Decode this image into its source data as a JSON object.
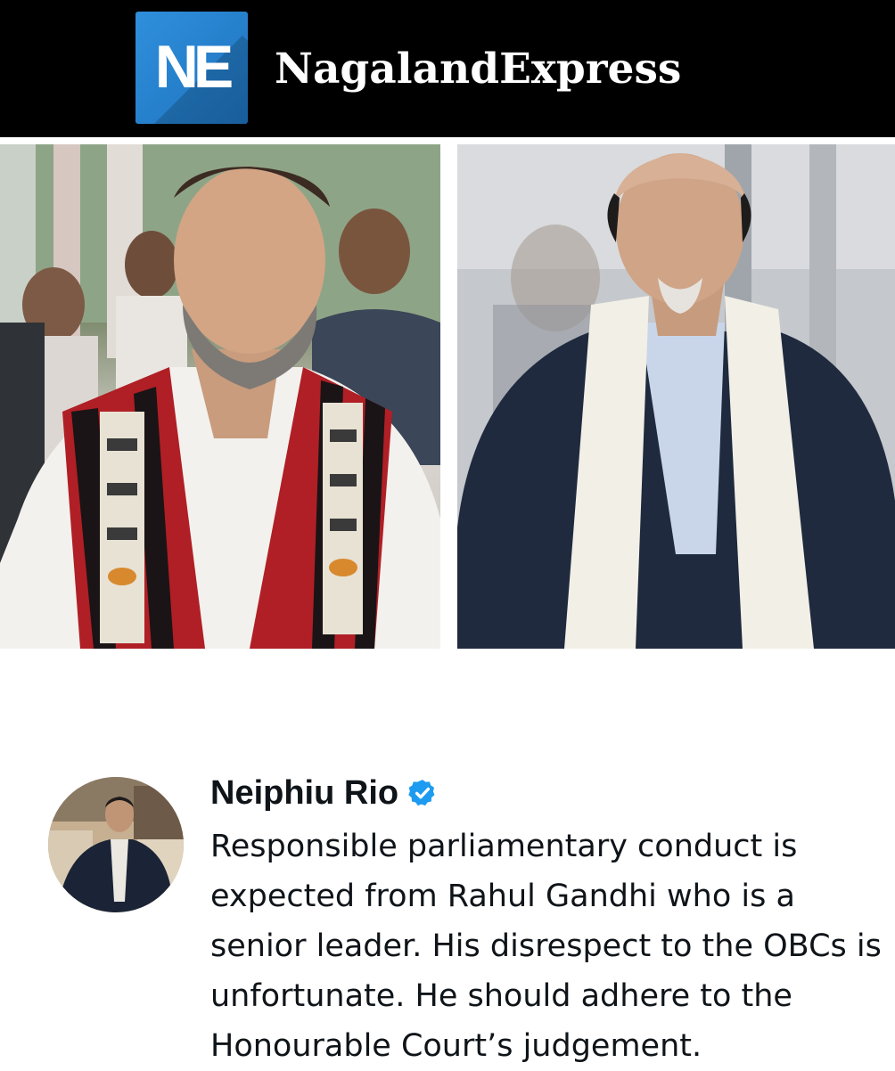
{
  "header": {
    "logo_text": "NE",
    "brand_name": "NagalandExpress",
    "background": "#000000",
    "logo_color": "#2a87d4"
  },
  "photos": {
    "left": "rahul-gandhi-photo",
    "right": "neiphiu-rio-photo"
  },
  "tweet": {
    "author": "Neiphiu Rio",
    "verified": true,
    "verified_color": "#1d9bf0",
    "text": "Responsible parliamentary conduct is expected from Rahul Gandhi who is a senior leader. His disrespect to the OBCs is unfortunate. He should adhere to the Honourable Court’s judgement."
  }
}
